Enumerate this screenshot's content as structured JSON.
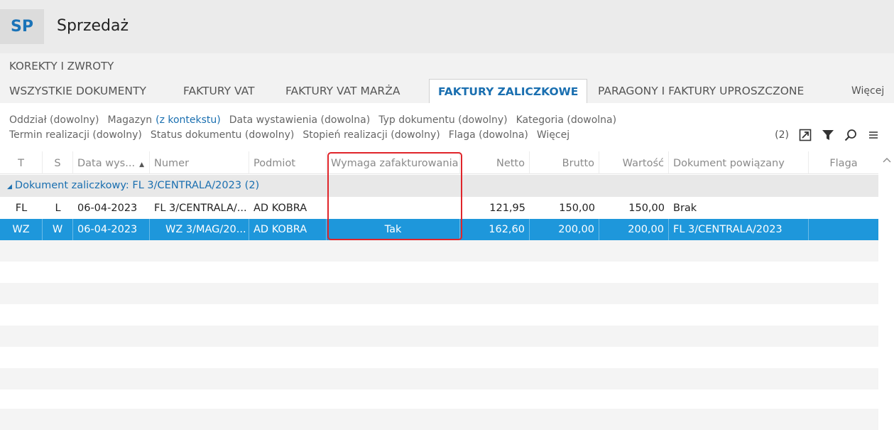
{
  "app": {
    "badge": "SP",
    "title": "Sprzedaż"
  },
  "tabs": {
    "parent": "KOREKTY I ZWROTY",
    "items": [
      {
        "label": "WSZYSTKIE DOKUMENTY"
      },
      {
        "label": "FAKTURY VAT"
      },
      {
        "label": "FAKTURY VAT MARŻA"
      },
      {
        "label": "FAKTURY ZALICZKOWE",
        "active": true
      },
      {
        "label": "PARAGONY I FAKTURY UPROSZCZONE"
      }
    ],
    "more": "Więcej"
  },
  "filters": {
    "row1": {
      "oddzial": "Oddział (dowolny)",
      "magazyn": "Magazyn",
      "magazyn_value": "(z kontekstu)",
      "data": "Data wystawienia (dowolna)",
      "typ": "Typ dokumentu (dowolny)",
      "kategoria": "Kategoria (dowolna)"
    },
    "row2": {
      "termin": "Termin realizacji (dowolny)",
      "status": "Status dokumentu (dowolny)",
      "stopien": "Stopień realizacji (dowolny)",
      "flaga": "Flaga (dowolna)",
      "wiecej": "Więcej"
    },
    "count": "(2)"
  },
  "icons": {
    "export": "export-icon",
    "filter": "filter-icon",
    "search": "search-icon",
    "menu": "menu-icon"
  },
  "table": {
    "columns": {
      "t": "T",
      "s": "S",
      "data": "Data wys...",
      "numer": "Numer",
      "podmiot": "Podmiot",
      "wymaga": "Wymaga zafakturowania",
      "netto": "Netto",
      "brutto": "Brutto",
      "wartosc": "Wartość",
      "dokument": "Dokument powiązany",
      "flaga": "Flaga"
    },
    "group": {
      "label": "Dokument zaliczkowy: FL 3/CENTRALA/2023 (2)"
    },
    "rows": [
      {
        "t": "FL",
        "s": "L",
        "data": "06-04-2023",
        "numer": "FL 3/CENTRALA/...",
        "podmiot": "AD KOBRA",
        "wymaga": "",
        "netto": "121,95",
        "brutto": "150,00",
        "wartosc": "150,00",
        "dokument": "Brak",
        "flaga": ""
      },
      {
        "t": "WZ",
        "s": "W",
        "data": "06-04-2023",
        "numer": "WZ 3/MAG/20...",
        "podmiot": "AD KOBRA",
        "wymaga": "Tak",
        "netto": "162,60",
        "brutto": "200,00",
        "wartosc": "200,00",
        "dokument": "FL 3/CENTRALA/2023",
        "flaga": ""
      }
    ]
  },
  "colors": {
    "accent": "#1a6fb0",
    "selected_row": "#1e97db",
    "highlight": "#e0252a"
  }
}
